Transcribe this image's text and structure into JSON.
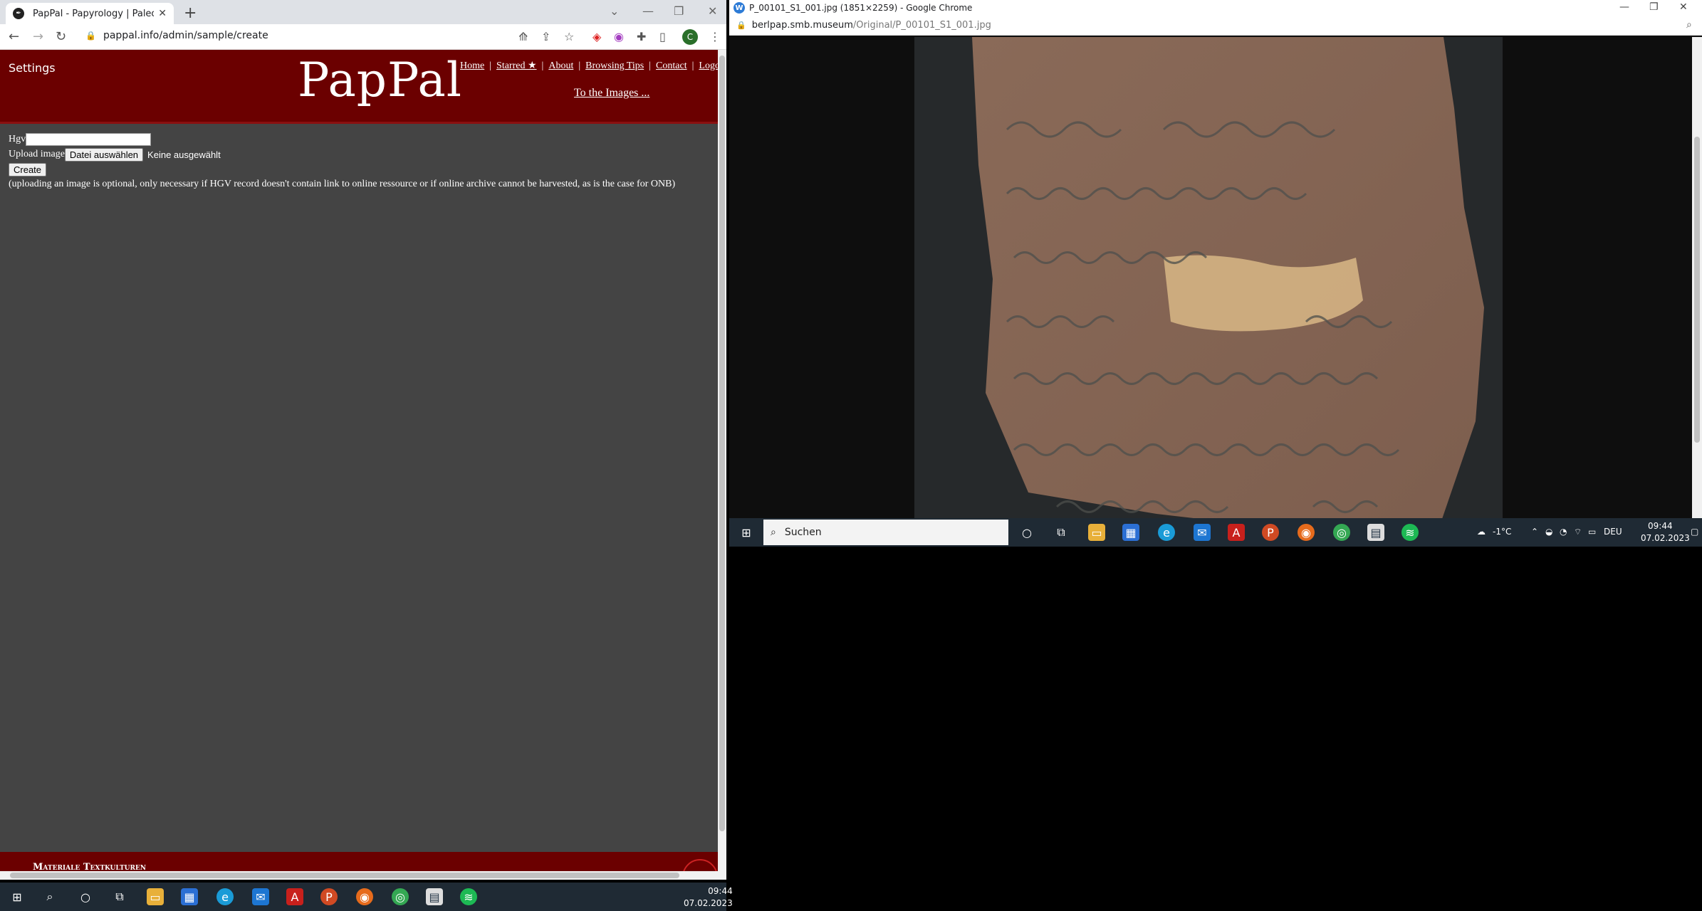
{
  "left_browser": {
    "tab_title": "PapPal - Papyrology | Paleograph",
    "url": "pappal.info/admin/sample/create",
    "avatar_letter": "C"
  },
  "page": {
    "settings": "Settings",
    "logo": "PapPal",
    "nav": [
      "Home",
      "Starred ★",
      "About",
      "Browsing Tips",
      "Contact",
      "Logou"
    ],
    "to_images": "To the Images ...",
    "form": {
      "hgv_label": "Hgv",
      "hgv_value": "",
      "upload_label": "Upload image",
      "file_button": "Datei auswählen",
      "no_file": "Keine ausgewählt",
      "create_button": "Create",
      "note": "(uploading an image is optional, only necessary if HGV record doesn't contain link to online ressource or if online archive cannot be harvested, as is the case for ONB)"
    },
    "footer": "Materiale Textkulturen"
  },
  "right_browser": {
    "title": "P_00101_S1_001.jpg (1851×2259) - Google Chrome",
    "url_host": "berlpap.smb.museum",
    "url_path": "/Original/P_00101_S1_001.jpg"
  },
  "inner_taskbar": {
    "search_placeholder": "Suchen",
    "weather": "-1°C",
    "lang": "DEU",
    "time": "09:44",
    "date": "07.02.2023"
  },
  "outer_taskbar": {
    "time": "09:44",
    "date": "07.02.2023"
  },
  "colors": {
    "header": "#6b0000",
    "page_bg": "#444444",
    "taskbar": "#1f2a34"
  }
}
